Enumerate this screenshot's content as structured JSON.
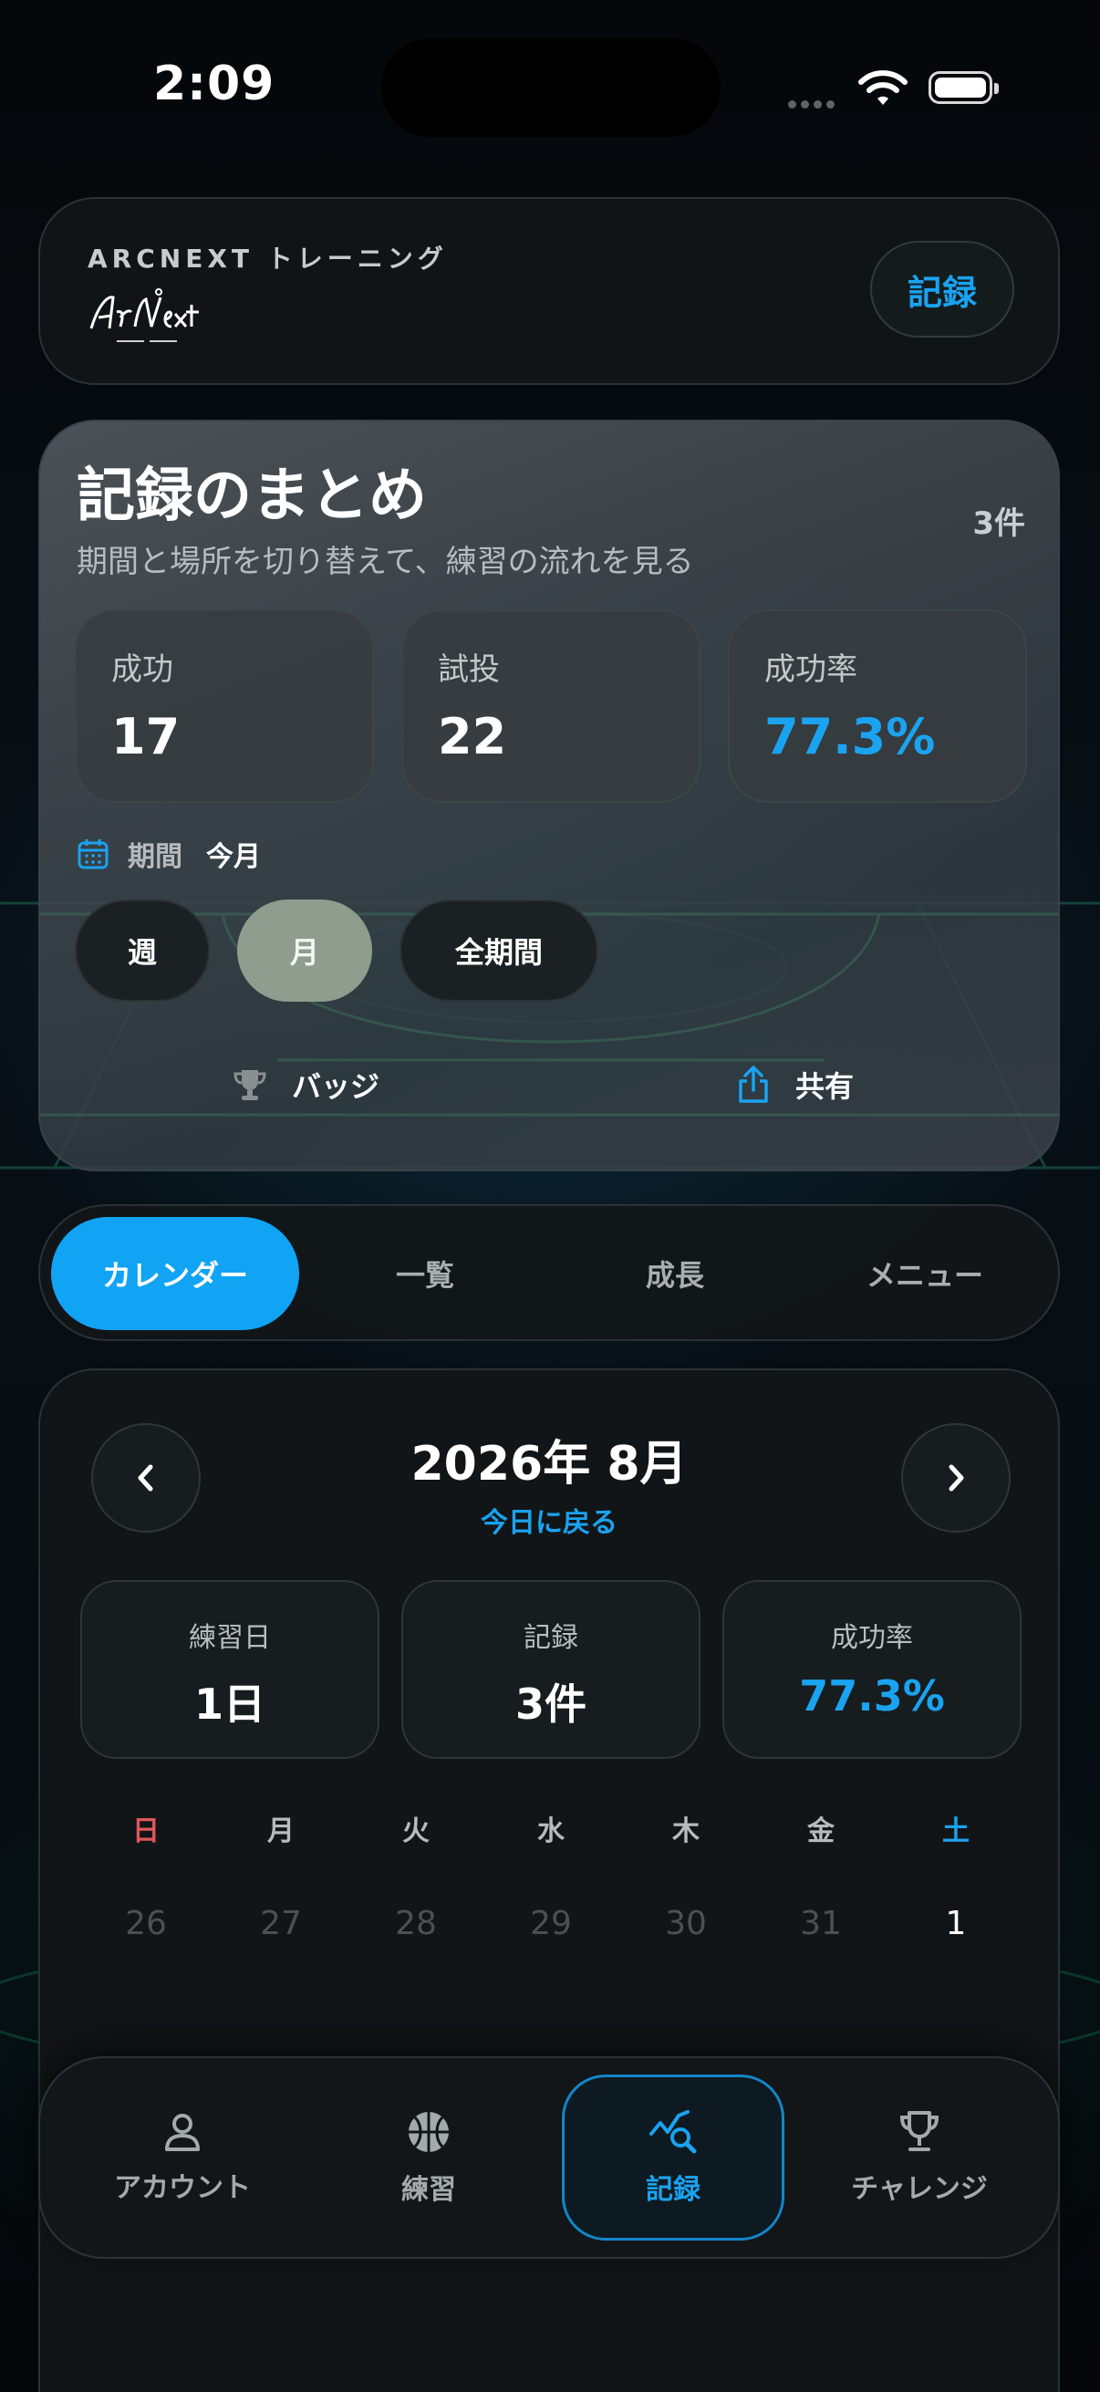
{
  "status_bar": {
    "time": "2:09"
  },
  "header": {
    "title": "ARCNEXT トレーニング",
    "logo_icon": "arcnext-logo-icon",
    "record_button": "記録"
  },
  "summary": {
    "title": "記録のまとめ",
    "count": "3件",
    "subtitle": "期間と場所を切り替えて、練習の流れを見る",
    "stats": [
      {
        "label": "成功",
        "value": "17"
      },
      {
        "label": "試投",
        "value": "22"
      },
      {
        "label": "成功率",
        "value": "77.3%"
      }
    ],
    "period_label": "期間",
    "period_value": "今月",
    "segments": [
      "週",
      "月",
      "全期間"
    ],
    "selected_segment": "月",
    "badge_label": "バッジ",
    "share_label": "共有"
  },
  "tabs": {
    "items": [
      "カレンダー",
      "一覧",
      "成長",
      "メニュー"
    ],
    "active": "カレンダー"
  },
  "calendar": {
    "month_title": "2026年 8月",
    "today_link": "今日に戻る",
    "stats": [
      {
        "label": "練習日",
        "value": "1日"
      },
      {
        "label": "記録",
        "value": "3件"
      },
      {
        "label": "成功率",
        "value": "77.3%"
      }
    ],
    "weekdays": [
      "日",
      "月",
      "火",
      "水",
      "木",
      "金",
      "土"
    ],
    "days": [
      "26",
      "27",
      "28",
      "29",
      "30",
      "31",
      "1"
    ]
  },
  "bottom_nav": {
    "items": [
      {
        "label": "アカウント",
        "icon": "person-icon"
      },
      {
        "label": "練習",
        "icon": "basketball-icon"
      },
      {
        "label": "記録",
        "icon": "chart-search-icon"
      },
      {
        "label": "チャレンジ",
        "icon": "trophy-icon"
      }
    ],
    "active": "記録"
  },
  "colors": {
    "accent": "#1aa3f0",
    "tab_active": "#11a3f4",
    "segment_active": "#8f9d8e",
    "sunday": "#e0565a",
    "saturday": "#1aa3f0"
  }
}
